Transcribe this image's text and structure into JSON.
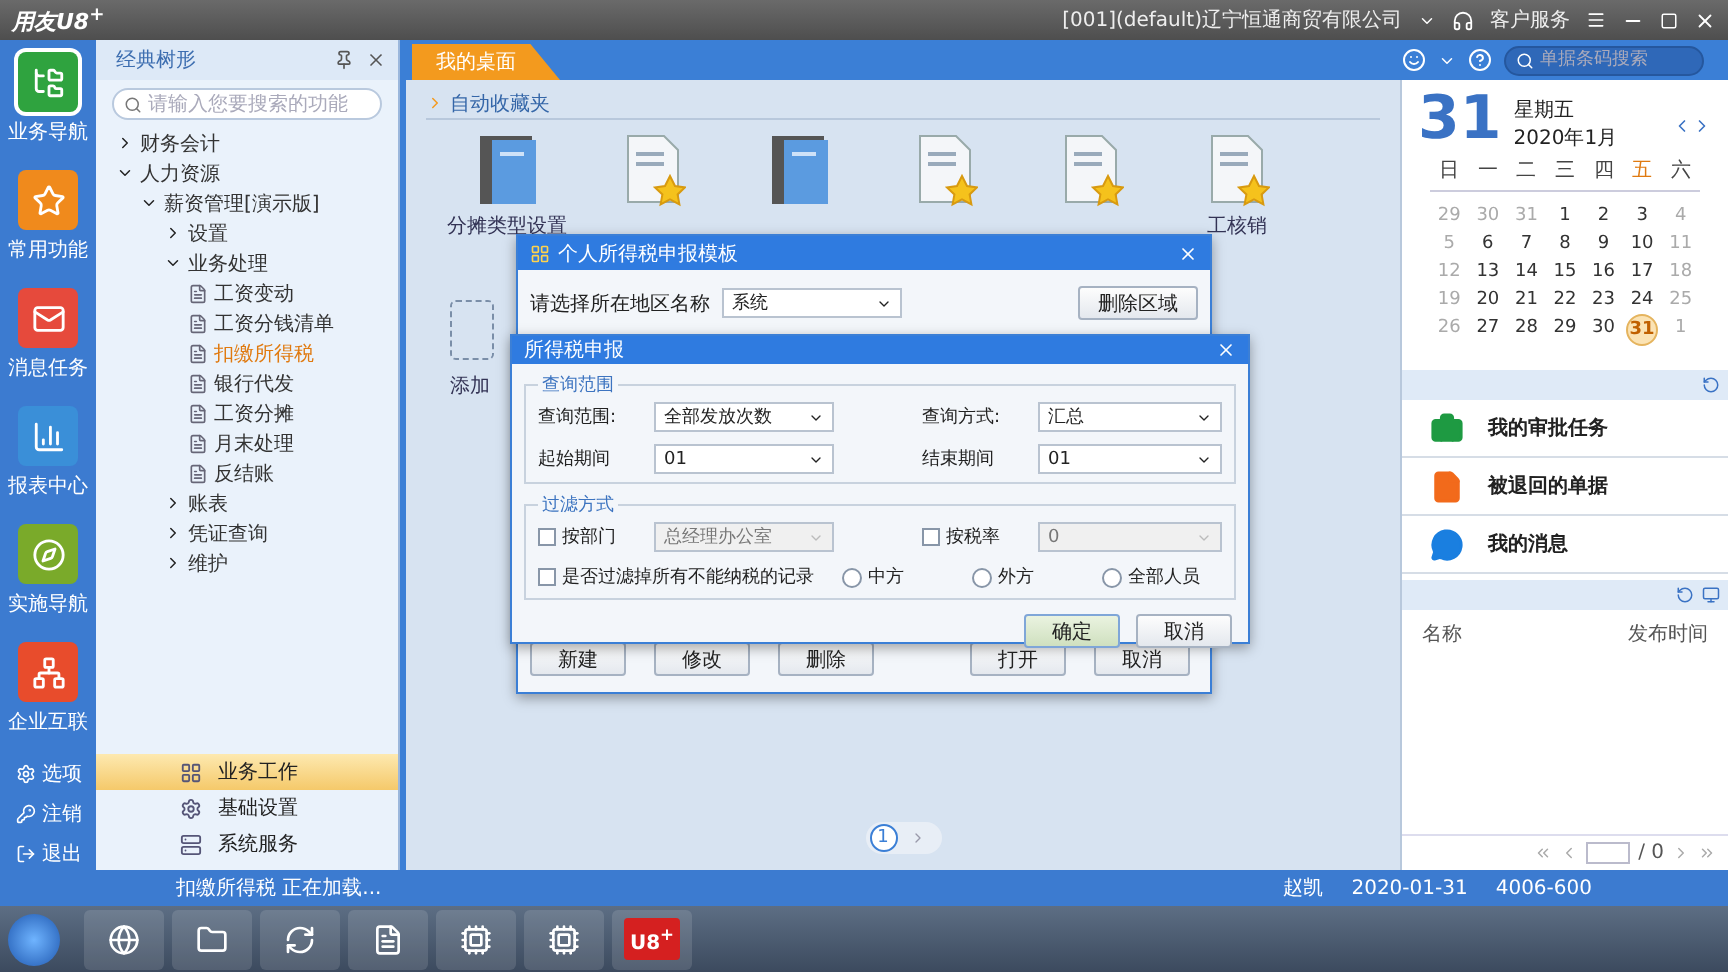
{
  "title_bar": {
    "logo": "用友U8$^{+}$",
    "company": "[001](default)辽宁恒通商贸有限公司",
    "service": "客户服务"
  },
  "nav": {
    "items": [
      {
        "label": "业务导航",
        "kind": "tree",
        "selected": true
      },
      {
        "label": "常用功能",
        "kind": "star",
        "selected": false
      },
      {
        "label": "消息任务",
        "kind": "mail",
        "selected": false
      },
      {
        "label": "报表中心",
        "kind": "report",
        "selected": false
      },
      {
        "label": "实施导航",
        "kind": "compass",
        "selected": false
      },
      {
        "label": "企业互联",
        "kind": "network",
        "selected": false
      }
    ],
    "bottom": [
      {
        "label": "选项",
        "kind": "gear"
      },
      {
        "label": "注销",
        "kind": "key"
      },
      {
        "label": "退出",
        "kind": "exit"
      }
    ]
  },
  "tree_panel": {
    "title": "经典树形",
    "search_placeholder": "请输入您要搜索的功能",
    "tree": [
      {
        "label": "财务会计",
        "kind": "folder",
        "expanded": false,
        "selected": false
      },
      {
        "label": "人力资源",
        "kind": "folder",
        "expanded": true,
        "selected": false,
        "children": [
          {
            "label": "薪资管理[演示版]",
            "kind": "folder",
            "expanded": true,
            "selected": false,
            "children": [
              {
                "label": "设置",
                "kind": "folder",
                "expanded": false,
                "selected": false
              },
              {
                "label": "业务处理",
                "kind": "folder",
                "expanded": true,
                "selected": false,
                "children": [
                  {
                    "label": "工资变动",
                    "kind": "leaf",
                    "selected": false
                  },
                  {
                    "label": "工资分钱清单",
                    "kind": "leaf",
                    "selected": false
                  },
                  {
                    "label": "扣缴所得税",
                    "kind": "leaf",
                    "selected": true
                  },
                  {
                    "label": "银行代发",
                    "kind": "leaf",
                    "selected": false
                  },
                  {
                    "label": "工资分摊",
                    "kind": "leaf",
                    "selected": false
                  },
                  {
                    "label": "月末处理",
                    "kind": "leaf",
                    "selected": false
                  },
                  {
                    "label": "反结账",
                    "kind": "leaf",
                    "selected": false
                  }
                ]
              },
              {
                "label": "账表",
                "kind": "folder",
                "expanded": false,
                "selected": false
              },
              {
                "label": "凭证查询",
                "kind": "folder",
                "expanded": false,
                "selected": false
              },
              {
                "label": "维护",
                "kind": "folder",
                "expanded": false,
                "selected": false
              }
            ]
          }
        ]
      }
    ],
    "modules": [
      {
        "label": "业务工作",
        "kind": "work",
        "selected": true
      },
      {
        "label": "基础设置",
        "kind": "gear",
        "selected": false
      },
      {
        "label": "系统服务",
        "kind": "service",
        "selected": false
      }
    ]
  },
  "tabs": [
    {
      "label": "我的桌面",
      "selected": true
    }
  ],
  "search": {
    "placeholder": "单据条码搜索"
  },
  "desktop": {
    "section": "自动收藏夹",
    "shortcuts": [
      {
        "label": "分摊类型设置",
        "kind": "book"
      },
      {
        "kind": "doc"
      },
      {
        "kind": "book"
      },
      {
        "kind": "doc"
      },
      {
        "kind": "doc"
      },
      {
        "label": "工核销",
        "kind": "doc"
      }
    ],
    "add_label": "添加",
    "pages": [
      {
        "label": "1",
        "selected": true
      }
    ]
  },
  "template_dialog": {
    "title": "个人所得税申报模板",
    "region_label": "请选择所在地区名称",
    "region_value": "系统",
    "delete_button": "删除区域",
    "buttons": [
      "新建",
      "修改",
      "删除",
      "打开",
      "取消"
    ]
  },
  "tax_dialog": {
    "title": "所得税申报",
    "query_group": {
      "title": "查询范围",
      "fields": [
        {
          "label": "查询范围:",
          "value": "全部发放次数"
        },
        {
          "label": "查询方式:",
          "value": "汇总"
        },
        {
          "label": "起始期间",
          "value": "01"
        },
        {
          "label": "结束期间",
          "value": "01"
        }
      ]
    },
    "filter_group": {
      "title": "过滤方式",
      "options": [
        {
          "label": "按部门",
          "checked": false,
          "value": "总经理办公室",
          "disabled": true
        },
        {
          "label": "按税率",
          "checked": false,
          "value": "0",
          "disabled": true
        }
      ],
      "exclude": {
        "label": "是否过滤掉所有不能纳税的记录",
        "checked": false
      },
      "radios": [
        {
          "label": "中方",
          "selected": false
        },
        {
          "label": "外方",
          "selected": false
        },
        {
          "label": "全部人员",
          "selected": false
        }
      ]
    },
    "ok": {
      "label": "确定",
      "focused": true
    },
    "cancel": "取消"
  },
  "calendar": {
    "day": "31",
    "weekday": "星期五",
    "month": "2020年1月",
    "weekdays": [
      {
        "label": "日",
        "today": false
      },
      {
        "label": "一",
        "today": false
      },
      {
        "label": "二",
        "today": false
      },
      {
        "label": "三",
        "today": false
      },
      {
        "label": "四",
        "today": false
      },
      {
        "label": "五",
        "today": true
      },
      {
        "label": "六",
        "today": false
      }
    ],
    "weeks": [
      [
        {
          "day": "29",
          "muted": true,
          "selected": false
        },
        {
          "day": "30",
          "muted": true,
          "selected": false
        },
        {
          "day": "31",
          "muted": true,
          "selected": false
        },
        {
          "day": "1",
          "muted": false,
          "selected": false
        },
        {
          "day": "2",
          "muted": false,
          "selected": false
        },
        {
          "day": "3",
          "muted": false,
          "selected": false
        },
        {
          "day": "4",
          "muted": true,
          "selected": false
        }
      ],
      [
        {
          "day": "5",
          "muted": true,
          "selected": false
        },
        {
          "day": "6",
          "muted": false,
          "selected": false
        },
        {
          "day": "7",
          "muted": false,
          "selected": false
        },
        {
          "day": "8",
          "muted": false,
          "selected": false
        },
        {
          "day": "9",
          "muted": false,
          "selected": false
        },
        {
          "day": "10",
          "muted": false,
          "selected": false
        },
        {
          "day": "11",
          "muted": true,
          "selected": false
        }
      ],
      [
        {
          "day": "12",
          "muted": true,
          "selected": false
        },
        {
          "day": "13",
          "muted": false,
          "selected": false
        },
        {
          "day": "14",
          "muted": false,
          "selected": false
        },
        {
          "day": "15",
          "muted": false,
          "selected": false
        },
        {
          "day": "16",
          "muted": false,
          "selected": false
        },
        {
          "day": "17",
          "muted": false,
          "selected": false
        },
        {
          "day": "18",
          "muted": true,
          "selected": false
        }
      ],
      [
        {
          "day": "19",
          "muted": true,
          "selected": false
        },
        {
          "day": "20",
          "muted": false,
          "selected": false
        },
        {
          "day": "21",
          "muted": false,
          "selected": false
        },
        {
          "day": "22",
          "muted": false,
          "selected": false
        },
        {
          "day": "23",
          "muted": false,
          "selected": false
        },
        {
          "day": "24",
          "muted": false,
          "selected": false
        },
        {
          "day": "25",
          "muted": true,
          "selected": false
        }
      ],
      [
        {
          "day": "26",
          "muted": true,
          "selected": false
        },
        {
          "day": "27",
          "muted": false,
          "selected": false
        },
        {
          "day": "28",
          "muted": false,
          "selected": false
        },
        {
          "day": "29",
          "muted": false,
          "selected": false
        },
        {
          "day": "30",
          "muted": false,
          "selected": false
        },
        {
          "day": "31",
          "muted": false,
          "selected": true
        },
        {
          "day": "1",
          "muted": true,
          "selected": false
        }
      ]
    ]
  },
  "tasks": [
    {
      "label": "我的审批任务",
      "kind": "briefcase"
    },
    {
      "label": "被退回的单据",
      "kind": "document"
    },
    {
      "label": "我的消息",
      "kind": "message"
    }
  ],
  "notices": {
    "columns": [
      "名称",
      "发布时间"
    ],
    "page_total": "/ 0"
  },
  "status_bar": {
    "message": "扣缴所得税 正在加载...",
    "user": "赵凯",
    "date": "2020-01-31",
    "phone": "4006-600"
  },
  "taskbar": {
    "apps": [
      {
        "kind": "browser"
      },
      {
        "kind": "folder"
      },
      {
        "kind": "sync"
      },
      {
        "kind": "office"
      },
      {
        "kind": "chip"
      },
      {
        "kind": "chip"
      },
      {
        "kind": "u8",
        "label": "U8$^{+}$"
      }
    ]
  }
}
